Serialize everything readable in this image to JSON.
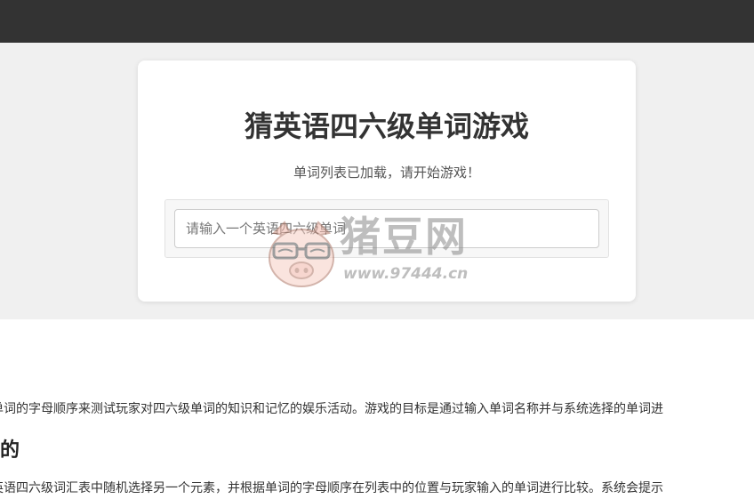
{
  "game": {
    "title": "猜英语四六级单词游戏",
    "status": "单词列表已加载，请开始游戏！",
    "input_placeholder": "请输入一个英语四六级单词"
  },
  "watermark": {
    "brand": "猪豆网",
    "url": "www.97444.cn"
  },
  "article": {
    "paragraph_1": "单词的字母顺序来测试玩家对四六级单词的知识和记忆的娱乐活动。游戏的目标是通过输入单词名称并与系统选择的单词进",
    "heading_1": "现的",
    "paragraph_2": "英语四六级词汇表中随机选择另一个元素，并根据单词的字母顺序在列表中的位置与玩家输入的单词进行比较。系统会提示"
  },
  "colors": {
    "topbar": "#333333",
    "stage": "#f0f0f0",
    "card": "#ffffff"
  }
}
